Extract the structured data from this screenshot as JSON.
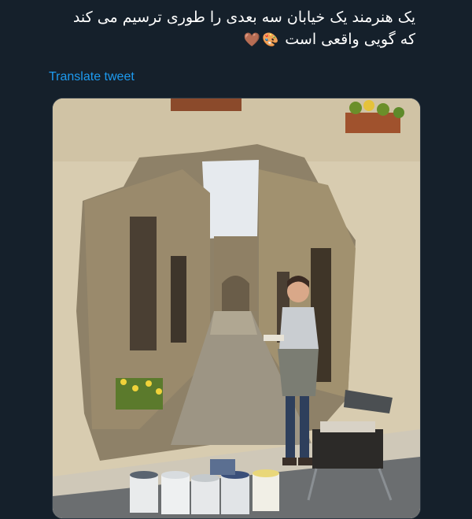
{
  "tweet": {
    "text_line_1": "یک هنرمند یک خیابان سه بعدی را طوری ترسیم می کند",
    "text_line_2": "که گویی واقعی است",
    "emoji_palette": "🎨",
    "emoji_heart": "🤎",
    "translate_label": "Translate tweet"
  },
  "media": {
    "description_icon": "photo",
    "colors": {
      "background": "#15202b",
      "link": "#1d9bf0",
      "wall": "#d9cdb2",
      "stone": "#8a7a60",
      "sky": "#e8ecef"
    }
  }
}
